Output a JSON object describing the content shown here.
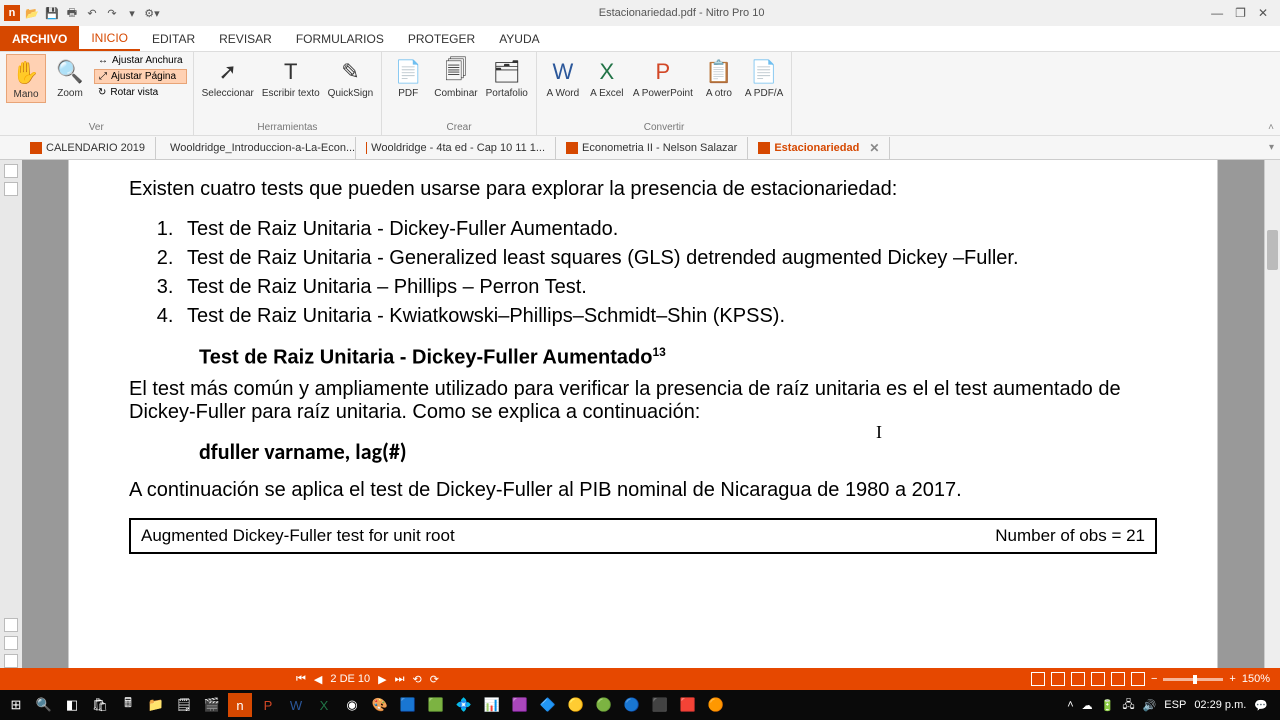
{
  "titlebar": {
    "title": "Estacionariedad.pdf - Nitro Pro 10"
  },
  "qat": {
    "open": "📂",
    "save": "💾",
    "print": "🖶",
    "undo": "↶",
    "redo": "↷"
  },
  "menu": {
    "archivo": "ARCHIVO",
    "inicio": "INICIO",
    "editar": "EDITAR",
    "revisar": "REVISAR",
    "formularios": "FORMULARIOS",
    "proteger": "PROTEGER",
    "ayuda": "AYUDA"
  },
  "ribbon": {
    "mano": "Mano",
    "zoom": "Zoom",
    "anchura": "Ajustar Anchura",
    "pagina": "Ajustar Página",
    "rotar": "Rotar vista",
    "ver": "Ver",
    "seleccionar": "Seleccionar",
    "escribir": "Escribir texto",
    "quicksign": "QuickSign",
    "herramientas": "Herramientas",
    "pdf": "PDF",
    "combinar": "Combinar",
    "portafolio": "Portafolio",
    "crear": "Crear",
    "word": "A Word",
    "excel": "A Excel",
    "ppt": "A PowerPoint",
    "otro": "A otro",
    "pdfa": "A PDF/A",
    "convertir": "Convertir"
  },
  "tabs": [
    "CALENDARIO  2019",
    "Wooldridge_Introduccion-a-La-Econ...",
    "Wooldridge - 4ta ed - Cap 10 11 1...",
    "Econometria II - Nelson Salazar",
    "Estacionariedad"
  ],
  "doc": {
    "intro": "Existen cuatro tests que pueden usarse para explorar la presencia de estacionariedad:",
    "items": [
      "Test de Raiz Unitaria - Dickey-Fuller Aumentado.",
      "Test de Raiz Unitaria - Generalized least squares (GLS) detrended augmented Dickey –Fuller.",
      "Test de Raiz Unitaria – Phillips – Perron Test.",
      "Test de Raiz Unitaria - Kwiatkowski–Phillips–Schmidt–Shin (KPSS)."
    ],
    "heading": "Test de Raiz Unitaria - Dickey-Fuller Aumentado",
    "sup": "13",
    "para": "El test más común y ampliamente utilizado para verificar la presencia de raíz unitaria es el el test aumentado de Dickey-Fuller para raíz unitaria. Como se explica a continuación:",
    "code": "dfuller varname, lag(#)",
    "para2": "A continuación se aplica el test de Dickey-Fuller al PIB nominal de Nicaragua de 1980 a 2017.",
    "table_left": "Augmented Dickey-Fuller test for unit root",
    "table_right": "Number of obs   =        21"
  },
  "status": {
    "page": "2 DE 10",
    "zoom": "150%"
  },
  "tray": {
    "lang": "ESP",
    "time": "02:29 p.m."
  }
}
